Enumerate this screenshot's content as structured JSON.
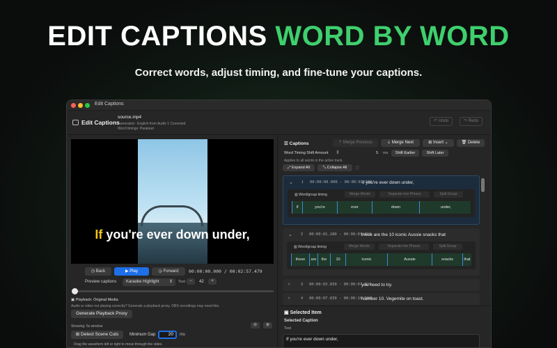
{
  "hero": {
    "title_white": "EDIT CAPTIONS",
    "title_green": "WORD BY WORD",
    "subtitle": "Correct words, adjust timing, and fine-tune your captions."
  },
  "window": {
    "title": "Edit Captions"
  },
  "toolbar": {
    "title": "Edit Captions",
    "file_name": "source.mp4",
    "meta_line1": "Generated - English from Audio 1 Corrected",
    "meta_line2": "Word timings: Parakeet",
    "undo": "Undo",
    "redo": "Redo"
  },
  "video": {
    "caption_highlight": "If",
    "caption_rest": " you're ever down under,"
  },
  "player": {
    "back": "Back",
    "play": "Play",
    "forward": "Forward",
    "current_time": "00:00:00.000",
    "separator": "/",
    "duration": "00:02:57.479",
    "preview_label": "Preview captions",
    "preview_mode": "Karaoke Highlight",
    "text_label": "Text",
    "minus": "−",
    "text_size": "42",
    "plus": "+"
  },
  "playback": {
    "title": "Playback: Original Media",
    "hint": "Audio or video not playing correctly? Generate a playback proxy. OBS recordings may need this.",
    "generate_button": "Generate Playback Proxy"
  },
  "waveform": {
    "showing": "Showing: 5s window",
    "detect_button": "Detect Scene Cuts",
    "min_gap_label": "Minimum Gap",
    "min_gap_value": "20",
    "min_gap_unit": "ms",
    "drag_hint": "Drag the waveform left or right to move through the video."
  },
  "captions_panel": {
    "title": "Captions",
    "merge_previous": "Merge Previous",
    "merge_next": "Merge Next",
    "insert": "Insert",
    "delete": "Delete",
    "shift_label": "Word Timing Shift Amount",
    "shift_value": "5",
    "shift_unit": "ms",
    "shift_earlier": "Shift Earlier",
    "shift_later": "Shift Later",
    "applies_hint": "Applies to all words in the active track.",
    "expand_all": "Expand All",
    "collapse_all": "Collapse All"
  },
  "captions": [
    {
      "index": "1",
      "time": "00:00:00.000 - 00:00:01.280",
      "text": "If you're ever down under,",
      "expanded": true,
      "words": [
        "If",
        "you're",
        "ever",
        "down",
        "under,"
      ]
    },
    {
      "index": "2",
      "time": "00:00:01.280 - 00:00:03.819",
      "text": "these are the 10 iconic Aussie snacks that",
      "expanded": true,
      "words": [
        "these",
        "are",
        "the",
        "10",
        "iconic",
        "Aussie",
        "snacks",
        "that"
      ]
    },
    {
      "index": "3",
      "time": "00:00:03.839 - 00:00:07.820",
      "text": "you need to try.",
      "expanded": false
    },
    {
      "index": "4",
      "time": "00:00:07.839 - 00:00:10.300",
      "text": "Number 10. Vegemite on toast.",
      "expanded": false
    }
  ],
  "word_group": {
    "label": "Word/group timing",
    "merge_words": "Merge Words",
    "separate": "Separate into Phrase",
    "split_group": "Split Group"
  },
  "selected": {
    "title": "Selected Item",
    "subtitle": "Selected Caption",
    "text_label": "Text",
    "text_value": "If you're ever down under,"
  }
}
